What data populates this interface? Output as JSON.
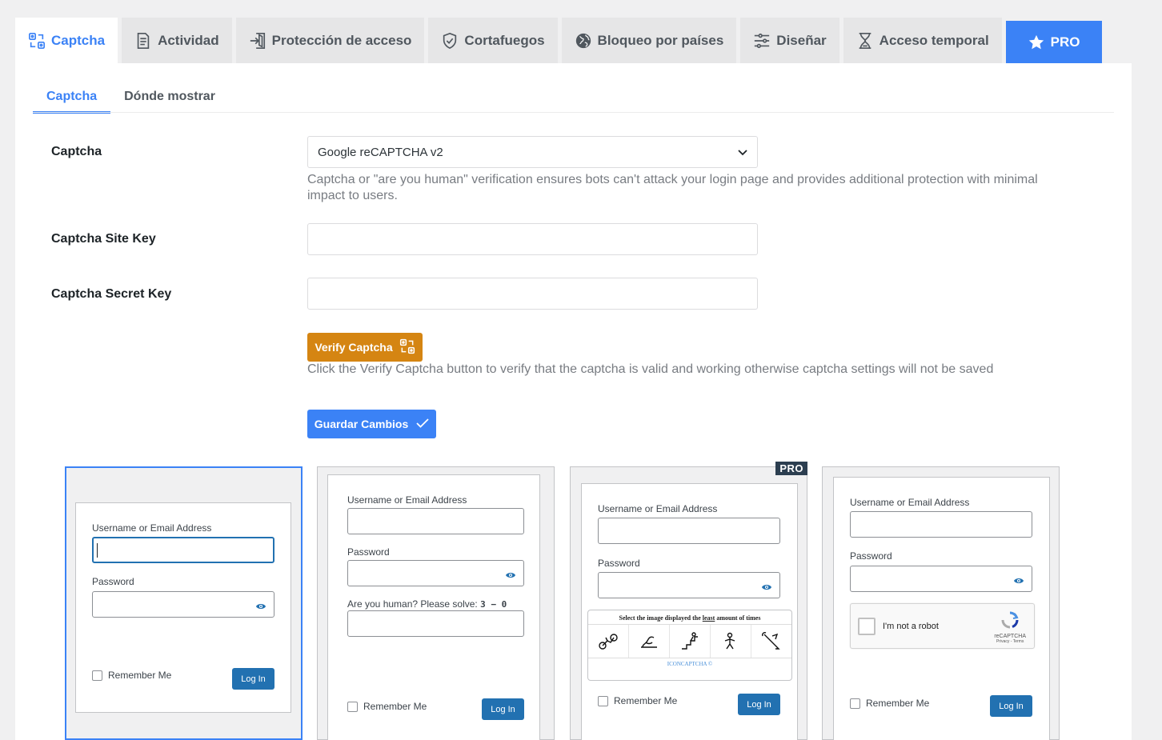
{
  "top_tabs": [
    {
      "label": "Captcha",
      "icon": "captcha-icon",
      "active": true
    },
    {
      "label": "Actividad",
      "icon": "document-icon"
    },
    {
      "label": "Protección de acceso",
      "icon": "login-door-icon"
    },
    {
      "label": "Cortafuegos",
      "icon": "shield-check-icon"
    },
    {
      "label": "Bloqueo por países",
      "icon": "globe-icon"
    },
    {
      "label": "Diseñar",
      "icon": "sliders-icon"
    },
    {
      "label": "Acceso temporal",
      "icon": "hourglass-icon"
    },
    {
      "label": "PRO",
      "icon": "star-icon"
    }
  ],
  "sub_tabs": [
    {
      "label": "Captcha",
      "active": true
    },
    {
      "label": "Dónde mostrar"
    }
  ],
  "form": {
    "captcha_label": "Captcha",
    "captcha_value": "Google reCAPTCHA v2",
    "captcha_help": "Captcha or \"are you human\" verification ensures bots can't attack your login page and provides additional protection with minimal impact to users.",
    "site_key_label": "Captcha Site Key",
    "site_key_value": "",
    "secret_key_label": "Captcha Secret Key",
    "secret_key_value": "",
    "verify_button": "Verify Captcha",
    "verify_help": "Click the Verify Captcha button to verify that the captcha is valid and working otherwise captcha settings will not be saved",
    "save_button": "Guardar Cambios"
  },
  "previews": {
    "username_label": "Username or Email Address",
    "password_label": "Password",
    "remember_label": "Remember Me",
    "login_button": "Log In",
    "math_label": "Are you human? Please solve:",
    "math_expression": "3 − 0",
    "pro_badge": "PRO",
    "icon_captcha_title_pre": "Select the image displayed the",
    "icon_captcha_title_em": "least",
    "icon_captcha_title_post": "amount of times",
    "icon_captcha_footer": "ICONCAPTCHA ©",
    "recaptcha_text": "I'm not a robot",
    "recaptcha_brand": "reCAPTCHA",
    "recaptcha_links": "Privacy - Terms"
  },
  "colors": {
    "accent": "#3b82f6",
    "verify": "#d58512",
    "wp_button": "#2271b1"
  }
}
